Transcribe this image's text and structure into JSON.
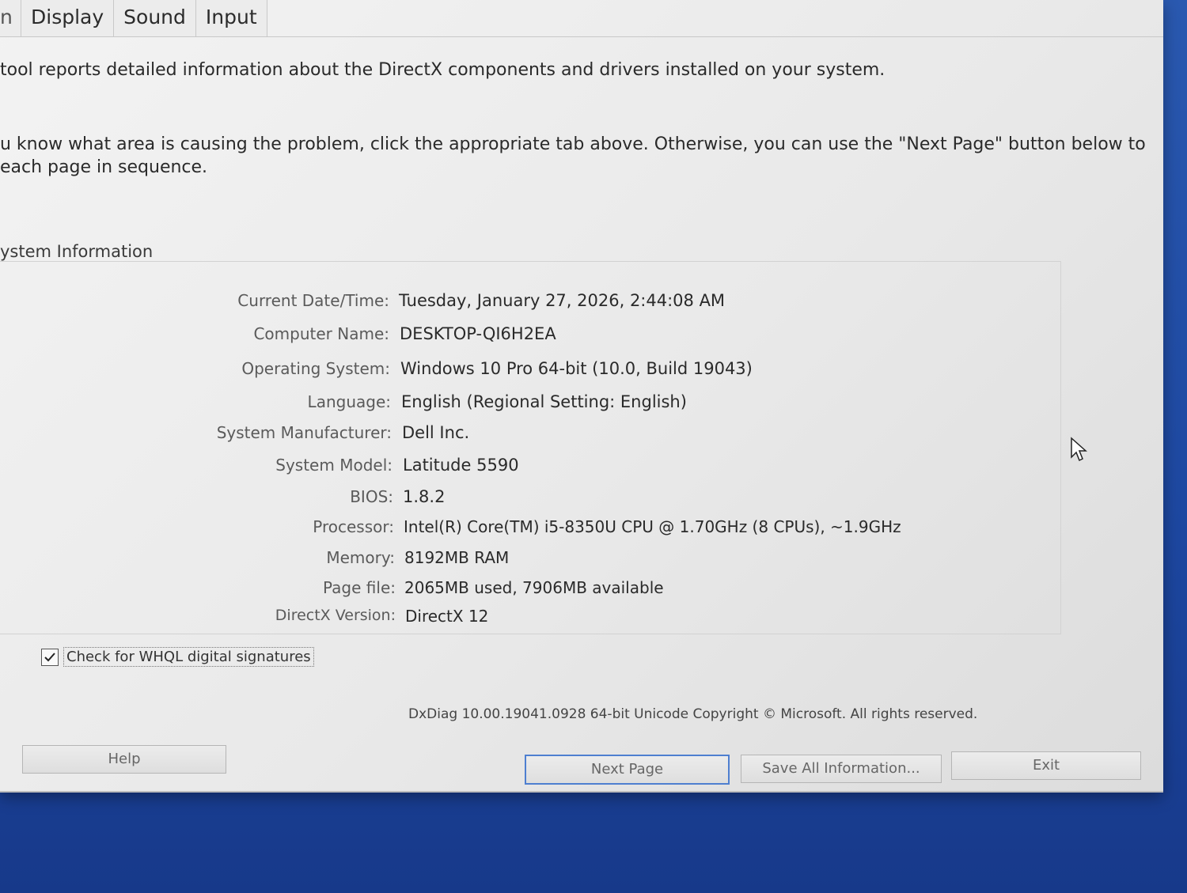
{
  "tabs": [
    {
      "label": "n"
    },
    {
      "label": "Display"
    },
    {
      "label": "Sound"
    },
    {
      "label": "Input"
    }
  ],
  "intro": {
    "line1": "tool reports detailed information about the DirectX components and drivers installed on your system.",
    "line2": "u know what area is causing the problem, click the appropriate tab above.  Otherwise, you can use the \"Next Page\" button below to",
    "line3": " each page in sequence."
  },
  "section_title": "ystem Information",
  "system_info": [
    {
      "label": "Current Date/Time:",
      "value": "Tuesday, January 27, 2026, 2:44:08 AM"
    },
    {
      "label": "Computer Name:",
      "value": "DESKTOP-QI6H2EA"
    },
    {
      "label": "Operating System:",
      "value": "Windows 10 Pro 64-bit (10.0, Build 19043)"
    },
    {
      "label": "Language:",
      "value": "English (Regional Setting: English)"
    },
    {
      "label": "System Manufacturer:",
      "value": "Dell Inc."
    },
    {
      "label": "System Model:",
      "value": "Latitude 5590"
    },
    {
      "label": "BIOS:",
      "value": "1.8.2"
    },
    {
      "label": "Processor:",
      "value": "Intel(R) Core(TM) i5-8350U CPU @ 1.70GHz (8 CPUs), ~1.9GHz"
    },
    {
      "label": "Memory:",
      "value": "8192MB RAM"
    },
    {
      "label": "Page file:",
      "value": "2065MB used, 7906MB available"
    },
    {
      "label": "DirectX Version:",
      "value": "DirectX 12"
    }
  ],
  "whql": {
    "label": "Check for WHQL digital signatures",
    "checked": true
  },
  "footer": {
    "copyright": "DxDiag 10.00.19041.0928 64-bit Unicode  Copyright © Microsoft. All rights reserved."
  },
  "buttons": {
    "help": "Help",
    "next_page": "Next Page",
    "save_all": "Save All Information...",
    "exit": "Exit"
  },
  "colors": {
    "desktop": "#1f4fa8",
    "default_button_border": "#4e7fd0"
  }
}
